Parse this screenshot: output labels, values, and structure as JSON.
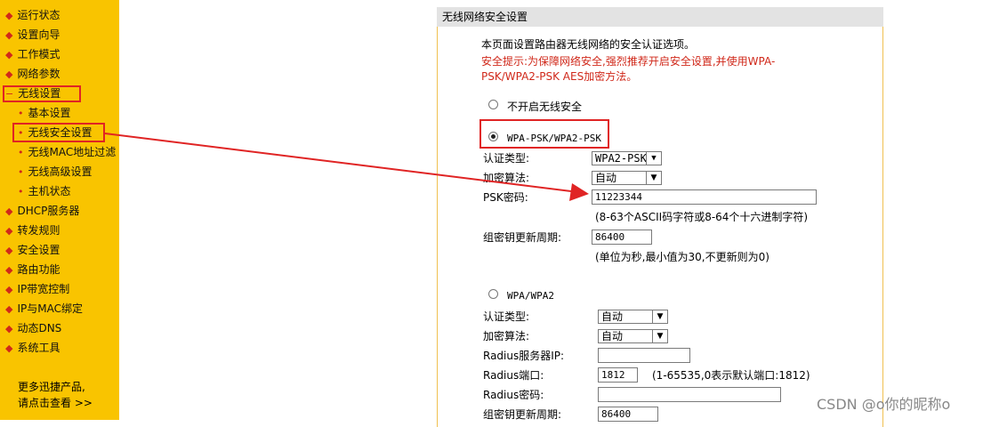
{
  "sidebar": {
    "items": [
      {
        "label": "运行状态"
      },
      {
        "label": "设置向导"
      },
      {
        "label": "工作模式"
      },
      {
        "label": "网络参数"
      },
      {
        "label": "无线设置"
      },
      {
        "label": "基本设置"
      },
      {
        "label": "无线安全设置"
      },
      {
        "label": "无线MAC地址过滤"
      },
      {
        "label": "无线高级设置"
      },
      {
        "label": "主机状态"
      },
      {
        "label": "DHCP服务器"
      },
      {
        "label": "转发规则"
      },
      {
        "label": "安全设置"
      },
      {
        "label": "路由功能"
      },
      {
        "label": "IP带宽控制"
      },
      {
        "label": "IP与MAC绑定"
      },
      {
        "label": "动态DNS"
      },
      {
        "label": "系统工具"
      }
    ],
    "footer_line1": "更多迅捷产品,",
    "footer_line2": "请点击查看 >>"
  },
  "panel": {
    "title": "无线网络安全设置",
    "intro": "本页面设置路由器无线网络的安全认证选项。",
    "warning_line1": "安全提示:为保障网络安全,强烈推荐开启安全设置,并使用WPA-",
    "warning_line2": "PSK/WPA2-PSK AES加密方法。",
    "opt_none": "不开启无线安全",
    "opt_psk": "WPA-PSK/WPA2-PSK",
    "psk": {
      "auth_label": "认证类型:",
      "auth_value": "WPA2-PSK",
      "enc_label": "加密算法:",
      "enc_value": "自动",
      "key_label": "PSK密码:",
      "key_value": "11223344",
      "key_hint": "(8-63个ASCII码字符或8-64个十六进制字符)",
      "renew_label": "组密钥更新周期:",
      "renew_value": "86400",
      "renew_hint": "(单位为秒,最小值为30,不更新则为0)"
    },
    "opt_wpa": "WPA/WPA2",
    "wpa": {
      "auth_label": "认证类型:",
      "auth_value": "自动",
      "enc_label": "加密算法:",
      "enc_value": "自动",
      "server_label": "Radius服务器IP:",
      "server_value": "",
      "port_label": "Radius端口:",
      "port_value": "1812",
      "port_hint": "(1-65535,0表示默认端口:1812)",
      "pwd_label": "Radius密码:",
      "pwd_value": "",
      "renew_label": "组密钥更新周期:",
      "renew_value": "86400"
    }
  },
  "watermark": "CSDN @o你的昵称o",
  "colors": {
    "sidebar_bg": "#f9c400",
    "highlight": "#e02424",
    "warning": "#d0281a"
  }
}
